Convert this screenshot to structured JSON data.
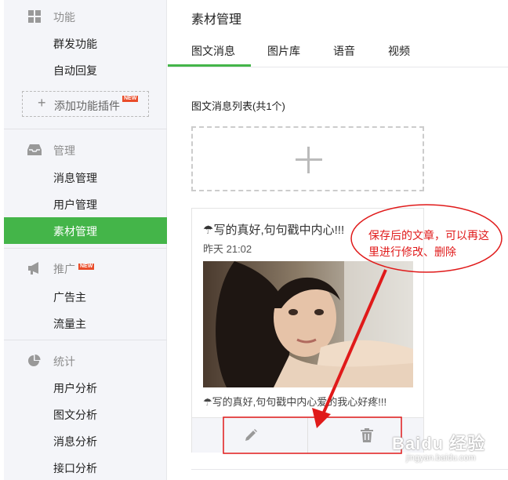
{
  "sidebar": {
    "sections": [
      {
        "title": "功能",
        "icon": "grid-icon",
        "items": [
          "群发功能",
          "自动回复"
        ]
      },
      {
        "title": "管理",
        "icon": "inbox-icon",
        "items": [
          "消息管理",
          "用户管理",
          "素材管理"
        ]
      },
      {
        "title": "推广",
        "icon": "megaphone-icon",
        "badge": "NEW",
        "items": [
          "广告主",
          "流量主"
        ]
      },
      {
        "title": "统计",
        "icon": "pie-chart-icon",
        "items": [
          "用户分析",
          "图文分析",
          "消息分析",
          "接口分析"
        ]
      }
    ],
    "add_plugin_label": "添加功能插件",
    "add_plugin_badge": "NEW",
    "active_item": "素材管理"
  },
  "main": {
    "title": "素材管理",
    "tabs": [
      "图文消息",
      "图片库",
      "语音",
      "视频"
    ],
    "active_tab": "图文消息",
    "list_title": "图文消息列表(共1个)",
    "article": {
      "title": "☂写的真好,句句戳中内心!!!",
      "time": "昨天 21:02",
      "digest": "☂写的真好,句句戳中内心爱的我心好疼!!!"
    }
  },
  "annotation": {
    "text": "保存后的文章，可以再这里进行修改、删除",
    "color": "#e01a1a"
  },
  "watermark": {
    "text": "Baidu 经验",
    "sub": "jingyan.baidu.com"
  },
  "colors": {
    "accent": "#44b549",
    "sidebar_bg": "#f4f5f9",
    "new_badge": "#e94c2a"
  }
}
